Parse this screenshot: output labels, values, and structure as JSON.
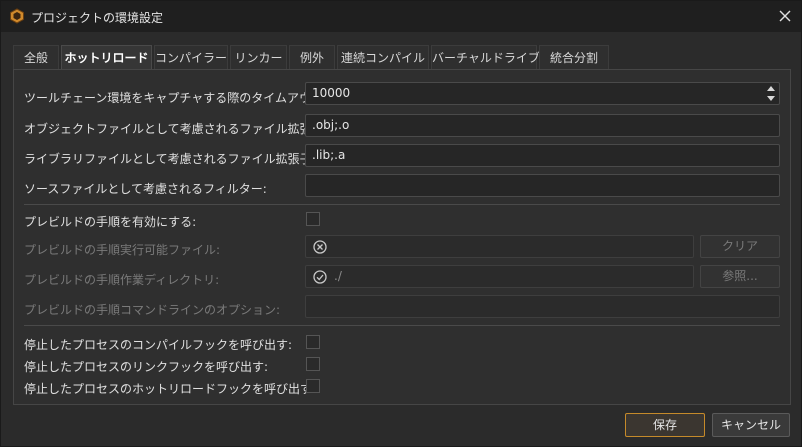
{
  "window": {
    "title": "プロジェクトの環境設定"
  },
  "tabs": [
    {
      "label": "全般"
    },
    {
      "label": "ホットリロード"
    },
    {
      "label": "コンパイラー"
    },
    {
      "label": "リンカー"
    },
    {
      "label": "例外"
    },
    {
      "label": "連続コンパイル"
    },
    {
      "label": "バーチャルドライブ"
    },
    {
      "label": "統合分割"
    }
  ],
  "settings": {
    "timeout": {
      "label": "ツールチェーン環境をキャプチャする際のタイムアウト (ミリ秒):",
      "value": "10000"
    },
    "object_ext": {
      "label": "オブジェクトファイルとして考慮されるファイル拡張子:",
      "value": ".obj;.o"
    },
    "library_ext": {
      "label": "ライブラリファイルとして考慮されるファイル拡張子:",
      "value": ".lib;.a"
    },
    "source_filter": {
      "label": "ソースファイルとして考慮されるフィルター:",
      "value": ""
    },
    "prebuild_enable": {
      "label": "プレビルドの手順を有効にする:",
      "checked": false
    },
    "prebuild_exe": {
      "label": "プレビルドの手順実行可能ファイル:",
      "value": "",
      "button": "クリア"
    },
    "prebuild_dir": {
      "label": "プレビルドの手順作業ディレクトリ:",
      "value": "./",
      "button": "参照..."
    },
    "prebuild_cmd": {
      "label": "プレビルドの手順コマンドラインのオプション:",
      "value": ""
    },
    "hook_compile": {
      "label": "停止したプロセスのコンパイルフックを呼び出す:",
      "checked": false
    },
    "hook_link": {
      "label": "停止したプロセスのリンクフックを呼び出す:",
      "checked": false
    },
    "hook_hotreload": {
      "label": "停止したプロセスのホットリロードフックを呼び出す:",
      "checked": false
    }
  },
  "footer": {
    "save": "保存",
    "cancel": "キャンセル"
  },
  "colors": {
    "accent": "#c58a2a",
    "background": "#2b2b2b",
    "panel": "#2f2f2f"
  }
}
